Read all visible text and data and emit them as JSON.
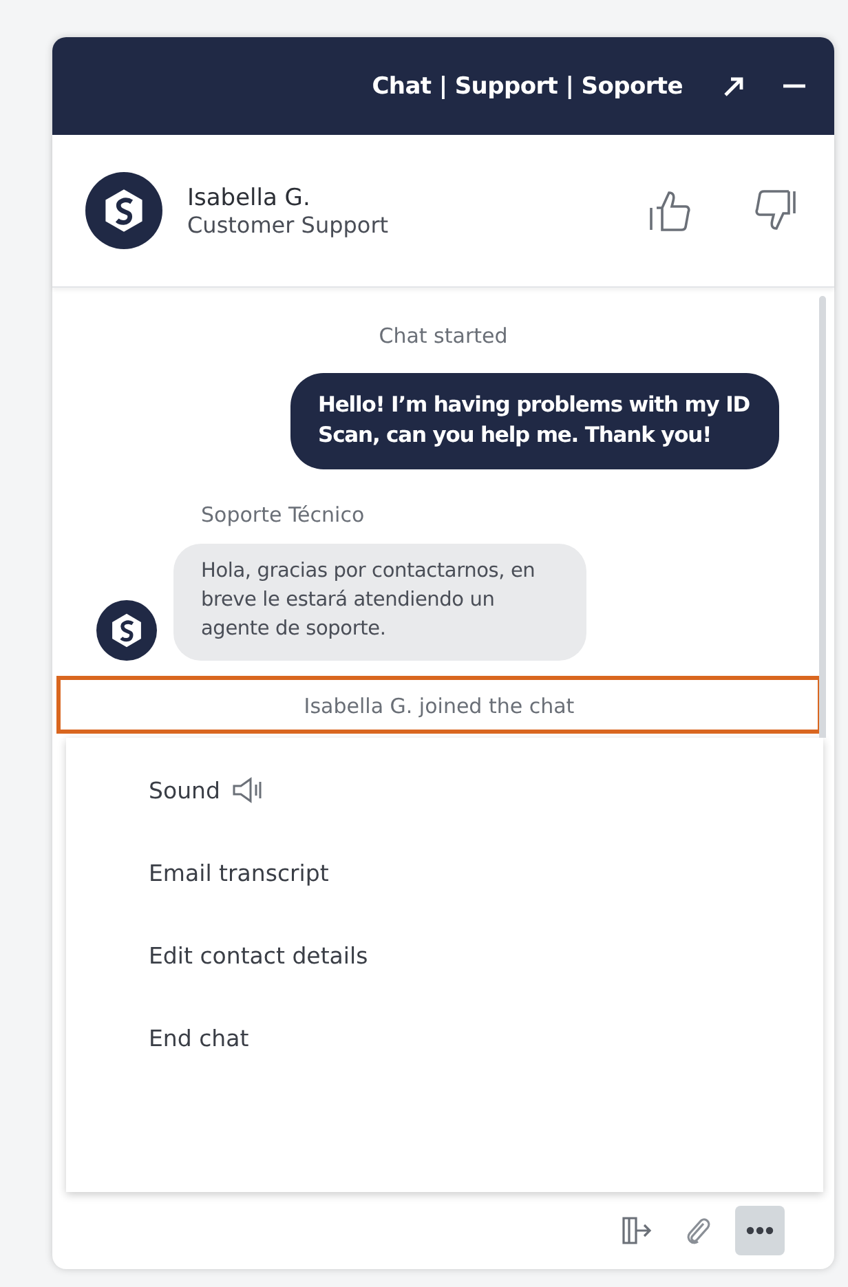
{
  "header": {
    "title": "Chat | Support | Soporte"
  },
  "agent": {
    "name": "Isabella G.",
    "role": "Customer Support"
  },
  "messages": [
    {
      "kind": "system",
      "text": "Chat started",
      "highlighted": false
    },
    {
      "kind": "outgoing",
      "text": "Hello! I’m having problems with my ID Scan, can you help me. Thank you!"
    },
    {
      "kind": "sender",
      "text": "Soporte Técnico"
    },
    {
      "kind": "incoming",
      "text": "Hola, gracias por contactarnos, en breve le estará atendiendo un agente de soporte."
    },
    {
      "kind": "system",
      "text": "Isabella G. joined the chat",
      "highlighted": true
    }
  ],
  "menu": {
    "open": true,
    "items": [
      {
        "label": "Sound",
        "kind": "sound"
      },
      {
        "label": "Email transcript",
        "kind": "plain"
      },
      {
        "label": "Edit contact details",
        "kind": "plain"
      },
      {
        "label": "End chat",
        "kind": "plain"
      }
    ]
  }
}
